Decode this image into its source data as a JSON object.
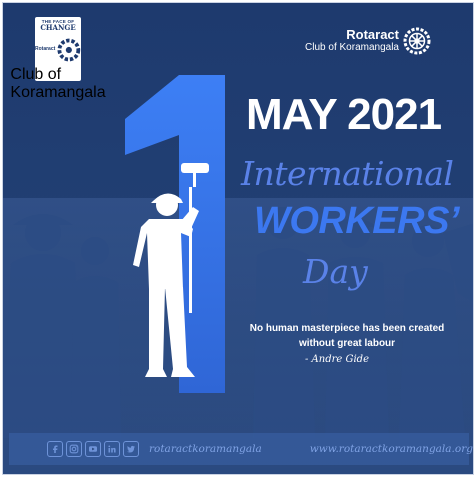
{
  "logo_left": {
    "line1": "THE FACE OF",
    "line2": "CHANGE",
    "brand": "Rotaract",
    "brand_sub": "Club of Koramangala"
  },
  "logo_right": {
    "name": "Rotaract",
    "sub": "Club of Koramangala",
    "icon": "rotary-wheel-icon"
  },
  "headline": {
    "big_number": "1",
    "date": "MAY 2021",
    "line1": "International",
    "line2": "WORKERS’",
    "line3": "Day"
  },
  "quote": {
    "text": "No human masterpiece has been created without great labour",
    "author": "- Andre Gide"
  },
  "footer": {
    "social_icons": [
      "facebook-icon",
      "instagram-icon",
      "youtube-icon",
      "linkedin-icon",
      "twitter-icon"
    ],
    "handle": "rotaractkoramangala",
    "url": "www.rotaractkoramangala.org"
  },
  "colors": {
    "background": "#1e3a6e",
    "accent_blue": "#3c78f0",
    "script_blue": "#5a82e8",
    "text_white": "#ffffff"
  }
}
